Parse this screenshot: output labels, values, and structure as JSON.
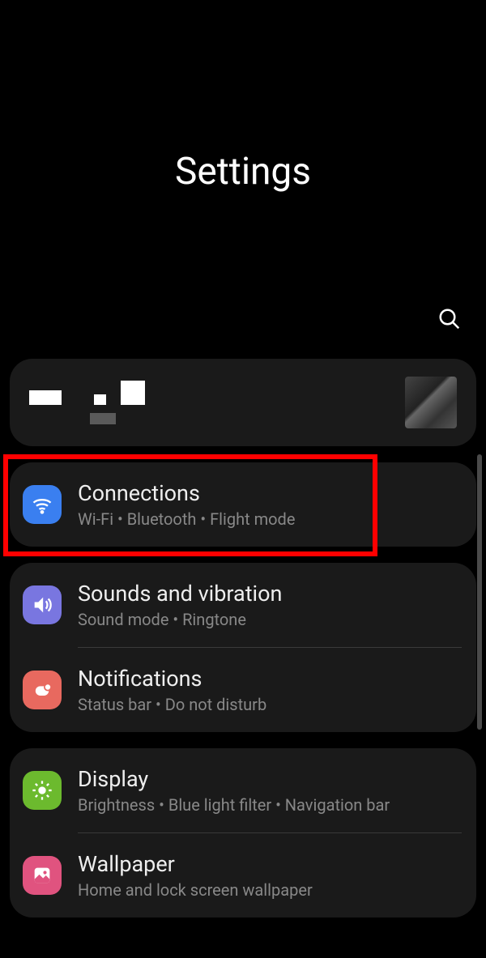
{
  "header": {
    "title": "Settings"
  },
  "groups": [
    {
      "items": [
        {
          "name": "connections",
          "icon": "wifi-icon",
          "icon_color": "icon-blue",
          "title": "Connections",
          "subtitle": "Wi-Fi  •  Bluetooth  •  Flight mode",
          "highlighted": true
        }
      ]
    },
    {
      "items": [
        {
          "name": "sounds",
          "icon": "sound-icon",
          "icon_color": "icon-purple",
          "title": "Sounds and vibration",
          "subtitle": "Sound mode  •  Ringtone"
        },
        {
          "name": "notifications",
          "icon": "notifications-icon",
          "icon_color": "icon-coral",
          "title": "Notifications",
          "subtitle": "Status bar  •  Do not disturb"
        }
      ]
    },
    {
      "items": [
        {
          "name": "display",
          "icon": "brightness-icon",
          "icon_color": "icon-green",
          "title": "Display",
          "subtitle": "Brightness  •  Blue light filter  •  Navigation bar"
        },
        {
          "name": "wallpaper",
          "icon": "wallpaper-icon",
          "icon_color": "icon-pink",
          "title": "Wallpaper",
          "subtitle": "Home and lock screen wallpaper"
        }
      ]
    }
  ]
}
